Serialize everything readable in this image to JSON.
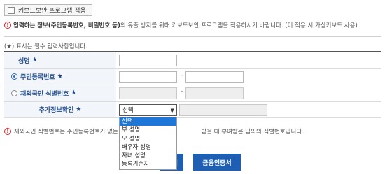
{
  "keyboard_security": {
    "label": "키보드보안 프로그램 적용"
  },
  "notice": {
    "prefix": "입력하는 정보",
    "highlight": "(주민등록번호, 비밀번호 등)",
    "suffix": "의 유출 방지를 위해 키보드보안 프로그램을 적용하시기 바랍니다. (미 적용 시 가상키보드 사용)"
  },
  "required_note": "(★) 표시는 필수 입력사항입니다.",
  "form": {
    "name_label": "성명",
    "rrn_label": "주민등록번호",
    "foreign_label": "재외국민 식별번호",
    "extra_label": "추가정보확인",
    "star": "★",
    "dash": "-",
    "select_value": "선택"
  },
  "dropdown_options": [
    "선택",
    "부 성명",
    "모 성명",
    "배우자 성명",
    "자녀 성명",
    "등록기준지"
  ],
  "info": {
    "text_left": "재외국민 식별번호는 주민등록번호가 없는 재",
    "text_right": "받을 때 부여받은 임의의 식별번호입니다."
  },
  "buttons": {
    "btn1_suffix": "서",
    "btn2": "금융인증서"
  }
}
